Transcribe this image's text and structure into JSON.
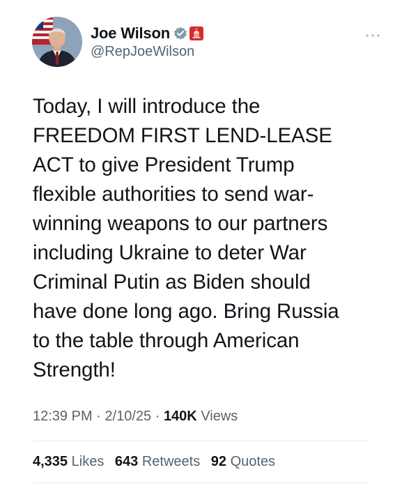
{
  "author": {
    "display_name": "Joe Wilson",
    "handle": "@RepJoeWilson",
    "verified_icon": "verified-badge-icon",
    "affiliation_icon": "us-capitol-icon",
    "avatar": "portrait-avatar",
    "colors": {
      "verified_badge": "#829aab",
      "affiliation_badge": "#d62b2b"
    }
  },
  "more_menu_icon": "more-horizontal-icon",
  "tweet": {
    "text": "Today, I will introduce the\nFREEDOM FIRST LEND-LEASE\nACT to give President Trump\nflexible authorities to send war-\nwinning weapons to our partners\nincluding Ukraine to deter War\nCriminal Putin as Biden should\nhave done long ago. Bring Russia\nto the table through American\nStrength!"
  },
  "meta": {
    "time": "12:39 PM",
    "separator": "·",
    "date": "2/10/25",
    "views_count": "140K",
    "views_label": "Views"
  },
  "stats": {
    "likes_count": "4,335",
    "likes_label": "Likes",
    "retweets_count": "643",
    "retweets_label": "Retweets",
    "quotes_count": "92",
    "quotes_label": "Quotes"
  }
}
